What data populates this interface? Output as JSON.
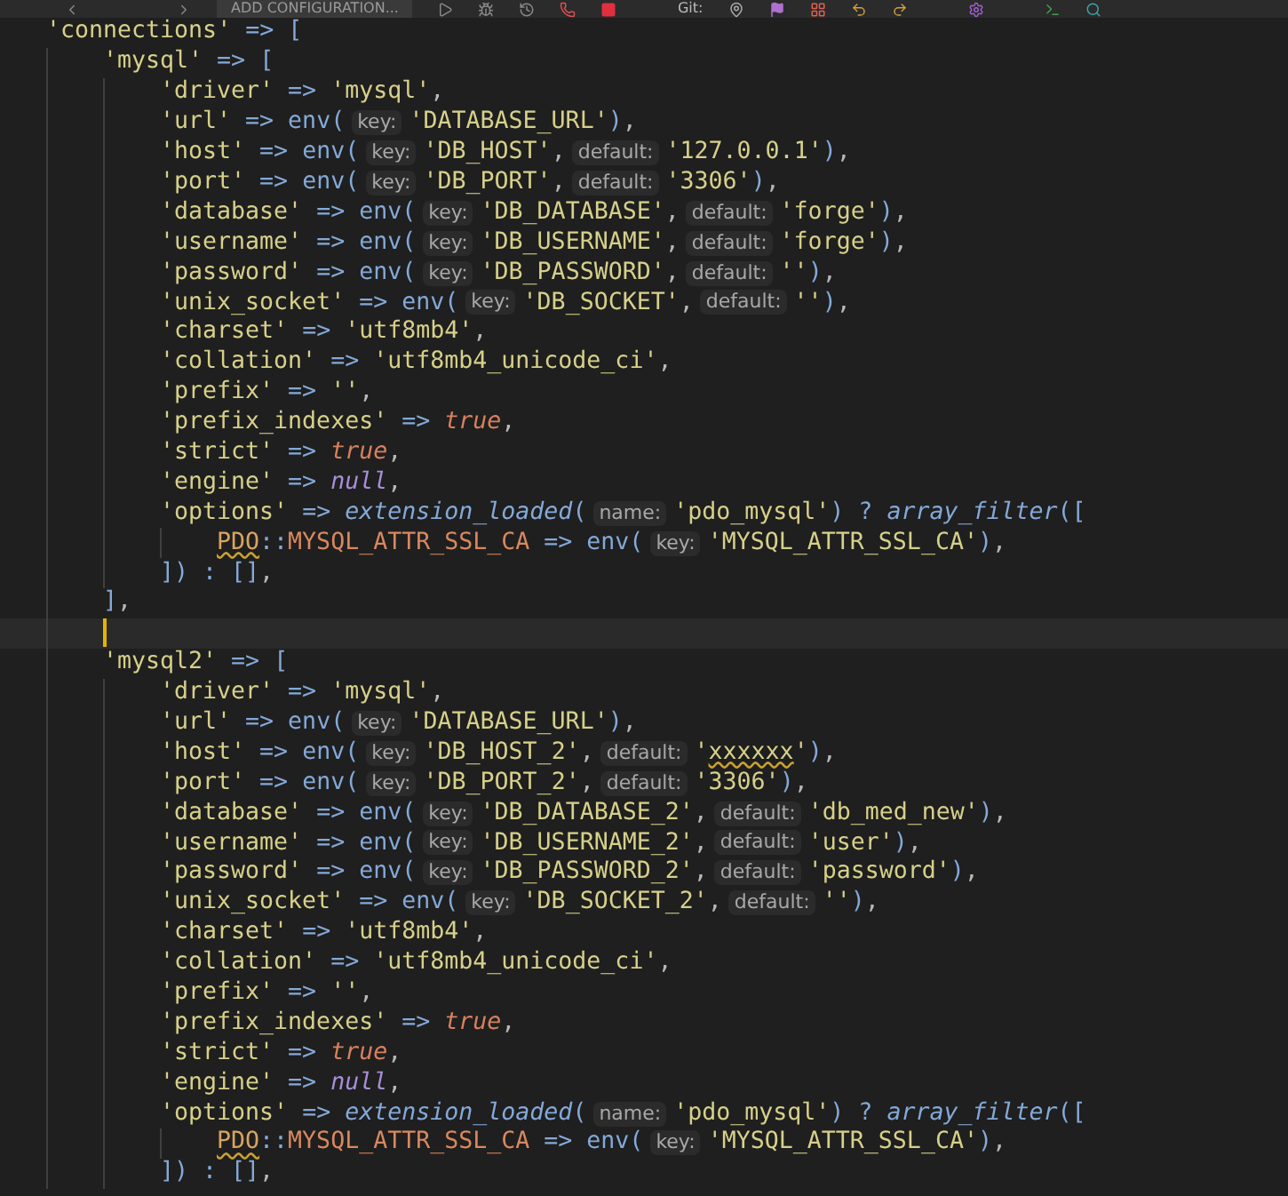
{
  "toolbar": {
    "config_button": "ADD CONFIGURATION...",
    "git_label": "Git:"
  },
  "lines": [
    {
      "current": false,
      "tokens": [
        {
          "kind": "s",
          "text": "'connections'"
        },
        {
          "kind": "op",
          "text": " => ["
        }
      ],
      "children": [
        {
          "current": false,
          "tokens": [
            {
              "kind": "s",
              "text": "'mysql'"
            },
            {
              "kind": "op",
              "text": " => ["
            }
          ],
          "children": [
            {
              "current": false,
              "tokens": [
                {
                  "kind": "s",
                  "text": "'driver'"
                },
                {
                  "kind": "op",
                  "text": " => "
                },
                {
                  "kind": "s",
                  "text": "'mysql'"
                },
                {
                  "kind": "p",
                  "text": ","
                }
              ]
            },
            {
              "current": false,
              "tokens": [
                {
                  "kind": "s",
                  "text": "'url'"
                },
                {
                  "kind": "op",
                  "text": " => env("
                },
                {
                  "kind": "hint",
                  "text": "key:"
                },
                {
                  "kind": "s",
                  "text": "'DATABASE_URL'"
                },
                {
                  "kind": "op",
                  "text": ")"
                },
                {
                  "kind": "p",
                  "text": ","
                }
              ]
            },
            {
              "current": false,
              "tokens": [
                {
                  "kind": "s",
                  "text": "'host'"
                },
                {
                  "kind": "op",
                  "text": " => env("
                },
                {
                  "kind": "hint",
                  "text": "key:"
                },
                {
                  "kind": "s",
                  "text": "'DB_HOST'"
                },
                {
                  "kind": "p",
                  "text": ","
                },
                {
                  "kind": "hint",
                  "text": "default:"
                },
                {
                  "kind": "s",
                  "text": "'127.0.0.1'"
                },
                {
                  "kind": "op",
                  "text": ")"
                },
                {
                  "kind": "p",
                  "text": ","
                }
              ]
            },
            {
              "current": false,
              "tokens": [
                {
                  "kind": "s",
                  "text": "'port'"
                },
                {
                  "kind": "op",
                  "text": " => env("
                },
                {
                  "kind": "hint",
                  "text": "key:"
                },
                {
                  "kind": "s",
                  "text": "'DB_PORT'"
                },
                {
                  "kind": "p",
                  "text": ","
                },
                {
                  "kind": "hint",
                  "text": "default:"
                },
                {
                  "kind": "s",
                  "text": "'3306'"
                },
                {
                  "kind": "op",
                  "text": ")"
                },
                {
                  "kind": "p",
                  "text": ","
                }
              ]
            },
            {
              "current": false,
              "tokens": [
                {
                  "kind": "s",
                  "text": "'database'"
                },
                {
                  "kind": "op",
                  "text": " => env("
                },
                {
                  "kind": "hint",
                  "text": "key:"
                },
                {
                  "kind": "s",
                  "text": "'DB_DATABASE'"
                },
                {
                  "kind": "p",
                  "text": ","
                },
                {
                  "kind": "hint",
                  "text": "default:"
                },
                {
                  "kind": "s",
                  "text": "'forge'"
                },
                {
                  "kind": "op",
                  "text": ")"
                },
                {
                  "kind": "p",
                  "text": ","
                }
              ]
            },
            {
              "current": false,
              "tokens": [
                {
                  "kind": "s",
                  "text": "'username'"
                },
                {
                  "kind": "op",
                  "text": " => env("
                },
                {
                  "kind": "hint",
                  "text": "key:"
                },
                {
                  "kind": "s",
                  "text": "'DB_USERNAME'"
                },
                {
                  "kind": "p",
                  "text": ","
                },
                {
                  "kind": "hint",
                  "text": "default:"
                },
                {
                  "kind": "s",
                  "text": "'forge'"
                },
                {
                  "kind": "op",
                  "text": ")"
                },
                {
                  "kind": "p",
                  "text": ","
                }
              ]
            },
            {
              "current": false,
              "tokens": [
                {
                  "kind": "s",
                  "text": "'password'"
                },
                {
                  "kind": "op",
                  "text": " => env("
                },
                {
                  "kind": "hint",
                  "text": "key:"
                },
                {
                  "kind": "s",
                  "text": "'DB_PASSWORD'"
                },
                {
                  "kind": "p",
                  "text": ","
                },
                {
                  "kind": "hint",
                  "text": "default:"
                },
                {
                  "kind": "s",
                  "text": "''"
                },
                {
                  "kind": "op",
                  "text": ")"
                },
                {
                  "kind": "p",
                  "text": ","
                }
              ]
            },
            {
              "current": false,
              "tokens": [
                {
                  "kind": "s",
                  "text": "'unix_socket'"
                },
                {
                  "kind": "op",
                  "text": " => env("
                },
                {
                  "kind": "hint",
                  "text": "key:"
                },
                {
                  "kind": "s",
                  "text": "'DB_SOCKET'"
                },
                {
                  "kind": "p",
                  "text": ","
                },
                {
                  "kind": "hint",
                  "text": "default:"
                },
                {
                  "kind": "s",
                  "text": "''"
                },
                {
                  "kind": "op",
                  "text": ")"
                },
                {
                  "kind": "p",
                  "text": ","
                }
              ]
            },
            {
              "current": false,
              "tokens": [
                {
                  "kind": "s",
                  "text": "'charset'"
                },
                {
                  "kind": "op",
                  "text": " => "
                },
                {
                  "kind": "s",
                  "text": "'utf8mb4'"
                },
                {
                  "kind": "p",
                  "text": ","
                }
              ]
            },
            {
              "current": false,
              "tokens": [
                {
                  "kind": "s",
                  "text": "'collation'"
                },
                {
                  "kind": "op",
                  "text": " => "
                },
                {
                  "kind": "s",
                  "text": "'utf8mb4_unicode_ci'"
                },
                {
                  "kind": "p",
                  "text": ","
                }
              ]
            },
            {
              "current": false,
              "tokens": [
                {
                  "kind": "s",
                  "text": "'prefix'"
                },
                {
                  "kind": "op",
                  "text": " => "
                },
                {
                  "kind": "s",
                  "text": "''"
                },
                {
                  "kind": "p",
                  "text": ","
                }
              ]
            },
            {
              "current": false,
              "tokens": [
                {
                  "kind": "s",
                  "text": "'prefix_indexes'"
                },
                {
                  "kind": "op",
                  "text": " => "
                },
                {
                  "kind": "bool",
                  "text": "true"
                },
                {
                  "kind": "p",
                  "text": ","
                }
              ]
            },
            {
              "current": false,
              "tokens": [
                {
                  "kind": "s",
                  "text": "'strict'"
                },
                {
                  "kind": "op",
                  "text": " => "
                },
                {
                  "kind": "bool",
                  "text": "true"
                },
                {
                  "kind": "p",
                  "text": ","
                }
              ]
            },
            {
              "current": false,
              "tokens": [
                {
                  "kind": "s",
                  "text": "'engine'"
                },
                {
                  "kind": "op",
                  "text": " => "
                },
                {
                  "kind": "null",
                  "text": "null"
                },
                {
                  "kind": "p",
                  "text": ","
                }
              ]
            },
            {
              "current": false,
              "tokens": [
                {
                  "kind": "s",
                  "text": "'options'"
                },
                {
                  "kind": "op",
                  "text": " => "
                },
                {
                  "kind": "fn",
                  "text": "extension_loaded"
                },
                {
                  "kind": "op",
                  "text": "("
                },
                {
                  "kind": "hint",
                  "text": "name:"
                },
                {
                  "kind": "s",
                  "text": "'pdo_mysql'"
                },
                {
                  "kind": "op",
                  "text": ") ? "
                },
                {
                  "kind": "fn",
                  "text": "array_filter"
                },
                {
                  "kind": "op",
                  "text": "(["
                }
              ],
              "children": [
                {
                  "current": false,
                  "tokens": [
                    {
                      "kind": "warncls",
                      "text": "PDO"
                    },
                    {
                      "kind": "op",
                      "text": "::"
                    },
                    {
                      "kind": "const",
                      "text": "MYSQL_ATTR_SSL_CA"
                    },
                    {
                      "kind": "op",
                      "text": " => env("
                    },
                    {
                      "kind": "hint",
                      "text": "key:"
                    },
                    {
                      "kind": "s",
                      "text": "'MYSQL_ATTR_SSL_CA'"
                    },
                    {
                      "kind": "op",
                      "text": ")"
                    },
                    {
                      "kind": "p",
                      "text": ","
                    }
                  ]
                }
              ]
            },
            {
              "current": false,
              "tokens": [
                {
                  "kind": "op",
                  "text": "]) : []"
                },
                {
                  "kind": "p",
                  "text": ","
                }
              ]
            }
          ]
        },
        {
          "current": false,
          "tokens": [
            {
              "kind": "op",
              "text": "]"
            },
            {
              "kind": "p",
              "text": ","
            }
          ]
        },
        {
          "current": true
        },
        {
          "current": false,
          "tokens": [
            {
              "kind": "s",
              "text": "'mysql2'"
            },
            {
              "kind": "op",
              "text": " => ["
            }
          ],
          "children": [
            {
              "current": false,
              "tokens": [
                {
                  "kind": "s",
                  "text": "'driver'"
                },
                {
                  "kind": "op",
                  "text": " => "
                },
                {
                  "kind": "s",
                  "text": "'mysql'"
                },
                {
                  "kind": "p",
                  "text": ","
                }
              ]
            },
            {
              "current": false,
              "tokens": [
                {
                  "kind": "s",
                  "text": "'url'"
                },
                {
                  "kind": "op",
                  "text": " => env("
                },
                {
                  "kind": "hint",
                  "text": "key:"
                },
                {
                  "kind": "s",
                  "text": "'DATABASE_URL'"
                },
                {
                  "kind": "op",
                  "text": ")"
                },
                {
                  "kind": "p",
                  "text": ","
                }
              ]
            },
            {
              "current": false,
              "tokens": [
                {
                  "kind": "s",
                  "text": "'host'"
                },
                {
                  "kind": "op",
                  "text": " => env("
                },
                {
                  "kind": "hint",
                  "text": "key:"
                },
                {
                  "kind": "s",
                  "text": "'DB_HOST_2'"
                },
                {
                  "kind": "p",
                  "text": ","
                },
                {
                  "kind": "hint",
                  "text": "default:"
                },
                {
                  "kind": "s",
                  "text": "'"
                },
                {
                  "kind": "warnstr",
                  "text": "xxxxxx"
                },
                {
                  "kind": "s",
                  "text": "'"
                },
                {
                  "kind": "op",
                  "text": ")"
                },
                {
                  "kind": "p",
                  "text": ","
                }
              ]
            },
            {
              "current": false,
              "tokens": [
                {
                  "kind": "s",
                  "text": "'port'"
                },
                {
                  "kind": "op",
                  "text": " => env("
                },
                {
                  "kind": "hint",
                  "text": "key:"
                },
                {
                  "kind": "s",
                  "text": "'DB_PORT_2'"
                },
                {
                  "kind": "p",
                  "text": ","
                },
                {
                  "kind": "hint",
                  "text": "default:"
                },
                {
                  "kind": "s",
                  "text": "'3306'"
                },
                {
                  "kind": "op",
                  "text": ")"
                },
                {
                  "kind": "p",
                  "text": ","
                }
              ]
            },
            {
              "current": false,
              "tokens": [
                {
                  "kind": "s",
                  "text": "'database'"
                },
                {
                  "kind": "op",
                  "text": " => env("
                },
                {
                  "kind": "hint",
                  "text": "key:"
                },
                {
                  "kind": "s",
                  "text": "'DB_DATABASE_2'"
                },
                {
                  "kind": "p",
                  "text": ","
                },
                {
                  "kind": "hint",
                  "text": "default:"
                },
                {
                  "kind": "s",
                  "text": "'db_med_new'"
                },
                {
                  "kind": "op",
                  "text": ")"
                },
                {
                  "kind": "p",
                  "text": ","
                }
              ]
            },
            {
              "current": false,
              "tokens": [
                {
                  "kind": "s",
                  "text": "'username'"
                },
                {
                  "kind": "op",
                  "text": " => env("
                },
                {
                  "kind": "hint",
                  "text": "key:"
                },
                {
                  "kind": "s",
                  "text": "'DB_USERNAME_2'"
                },
                {
                  "kind": "p",
                  "text": ","
                },
                {
                  "kind": "hint",
                  "text": "default:"
                },
                {
                  "kind": "s",
                  "text": "'user'"
                },
                {
                  "kind": "op",
                  "text": ")"
                },
                {
                  "kind": "p",
                  "text": ","
                }
              ]
            },
            {
              "current": false,
              "tokens": [
                {
                  "kind": "s",
                  "text": "'password'"
                },
                {
                  "kind": "op",
                  "text": " => env("
                },
                {
                  "kind": "hint",
                  "text": "key:"
                },
                {
                  "kind": "s",
                  "text": "'DB_PASSWORD_2'"
                },
                {
                  "kind": "p",
                  "text": ","
                },
                {
                  "kind": "hint",
                  "text": "default:"
                },
                {
                  "kind": "s",
                  "text": "'password'"
                },
                {
                  "kind": "op",
                  "text": ")"
                },
                {
                  "kind": "p",
                  "text": ","
                }
              ]
            },
            {
              "current": false,
              "tokens": [
                {
                  "kind": "s",
                  "text": "'unix_socket'"
                },
                {
                  "kind": "op",
                  "text": " => env("
                },
                {
                  "kind": "hint",
                  "text": "key:"
                },
                {
                  "kind": "s",
                  "text": "'DB_SOCKET_2'"
                },
                {
                  "kind": "p",
                  "text": ","
                },
                {
                  "kind": "hint",
                  "text": "default:"
                },
                {
                  "kind": "s",
                  "text": "''"
                },
                {
                  "kind": "op",
                  "text": ")"
                },
                {
                  "kind": "p",
                  "text": ","
                }
              ]
            },
            {
              "current": false,
              "tokens": [
                {
                  "kind": "s",
                  "text": "'charset'"
                },
                {
                  "kind": "op",
                  "text": " => "
                },
                {
                  "kind": "s",
                  "text": "'utf8mb4'"
                },
                {
                  "kind": "p",
                  "text": ","
                }
              ]
            },
            {
              "current": false,
              "tokens": [
                {
                  "kind": "s",
                  "text": "'collation'"
                },
                {
                  "kind": "op",
                  "text": " => "
                },
                {
                  "kind": "s",
                  "text": "'utf8mb4_unicode_ci'"
                },
                {
                  "kind": "p",
                  "text": ","
                }
              ]
            },
            {
              "current": false,
              "tokens": [
                {
                  "kind": "s",
                  "text": "'prefix'"
                },
                {
                  "kind": "op",
                  "text": " => "
                },
                {
                  "kind": "s",
                  "text": "''"
                },
                {
                  "kind": "p",
                  "text": ","
                }
              ]
            },
            {
              "current": false,
              "tokens": [
                {
                  "kind": "s",
                  "text": "'prefix_indexes'"
                },
                {
                  "kind": "op",
                  "text": " => "
                },
                {
                  "kind": "bool",
                  "text": "true"
                },
                {
                  "kind": "p",
                  "text": ","
                }
              ]
            },
            {
              "current": false,
              "tokens": [
                {
                  "kind": "s",
                  "text": "'strict'"
                },
                {
                  "kind": "op",
                  "text": " => "
                },
                {
                  "kind": "bool",
                  "text": "true"
                },
                {
                  "kind": "p",
                  "text": ","
                }
              ]
            },
            {
              "current": false,
              "tokens": [
                {
                  "kind": "s",
                  "text": "'engine'"
                },
                {
                  "kind": "op",
                  "text": " => "
                },
                {
                  "kind": "null",
                  "text": "null"
                },
                {
                  "kind": "p",
                  "text": ","
                }
              ]
            },
            {
              "current": false,
              "tokens": [
                {
                  "kind": "s",
                  "text": "'options'"
                },
                {
                  "kind": "op",
                  "text": " => "
                },
                {
                  "kind": "fn",
                  "text": "extension_loaded"
                },
                {
                  "kind": "op",
                  "text": "("
                },
                {
                  "kind": "hint",
                  "text": "name:"
                },
                {
                  "kind": "s",
                  "text": "'pdo_mysql'"
                },
                {
                  "kind": "op",
                  "text": ") ? "
                },
                {
                  "kind": "fn",
                  "text": "array_filter"
                },
                {
                  "kind": "op",
                  "text": "(["
                }
              ],
              "children": [
                {
                  "current": false,
                  "tokens": [
                    {
                      "kind": "warncls",
                      "text": "PDO"
                    },
                    {
                      "kind": "op",
                      "text": "::"
                    },
                    {
                      "kind": "const",
                      "text": "MYSQL_ATTR_SSL_CA"
                    },
                    {
                      "kind": "op",
                      "text": " => env("
                    },
                    {
                      "kind": "hint",
                      "text": "key:"
                    },
                    {
                      "kind": "s",
                      "text": "'MYSQL_ATTR_SSL_CA'"
                    },
                    {
                      "kind": "op",
                      "text": ")"
                    },
                    {
                      "kind": "p",
                      "text": ","
                    }
                  ]
                }
              ]
            },
            {
              "current": false,
              "tokens": [
                {
                  "kind": "op",
                  "text": "]) : []"
                },
                {
                  "kind": "p",
                  "text": ","
                }
              ]
            }
          ]
        }
      ]
    }
  ]
}
